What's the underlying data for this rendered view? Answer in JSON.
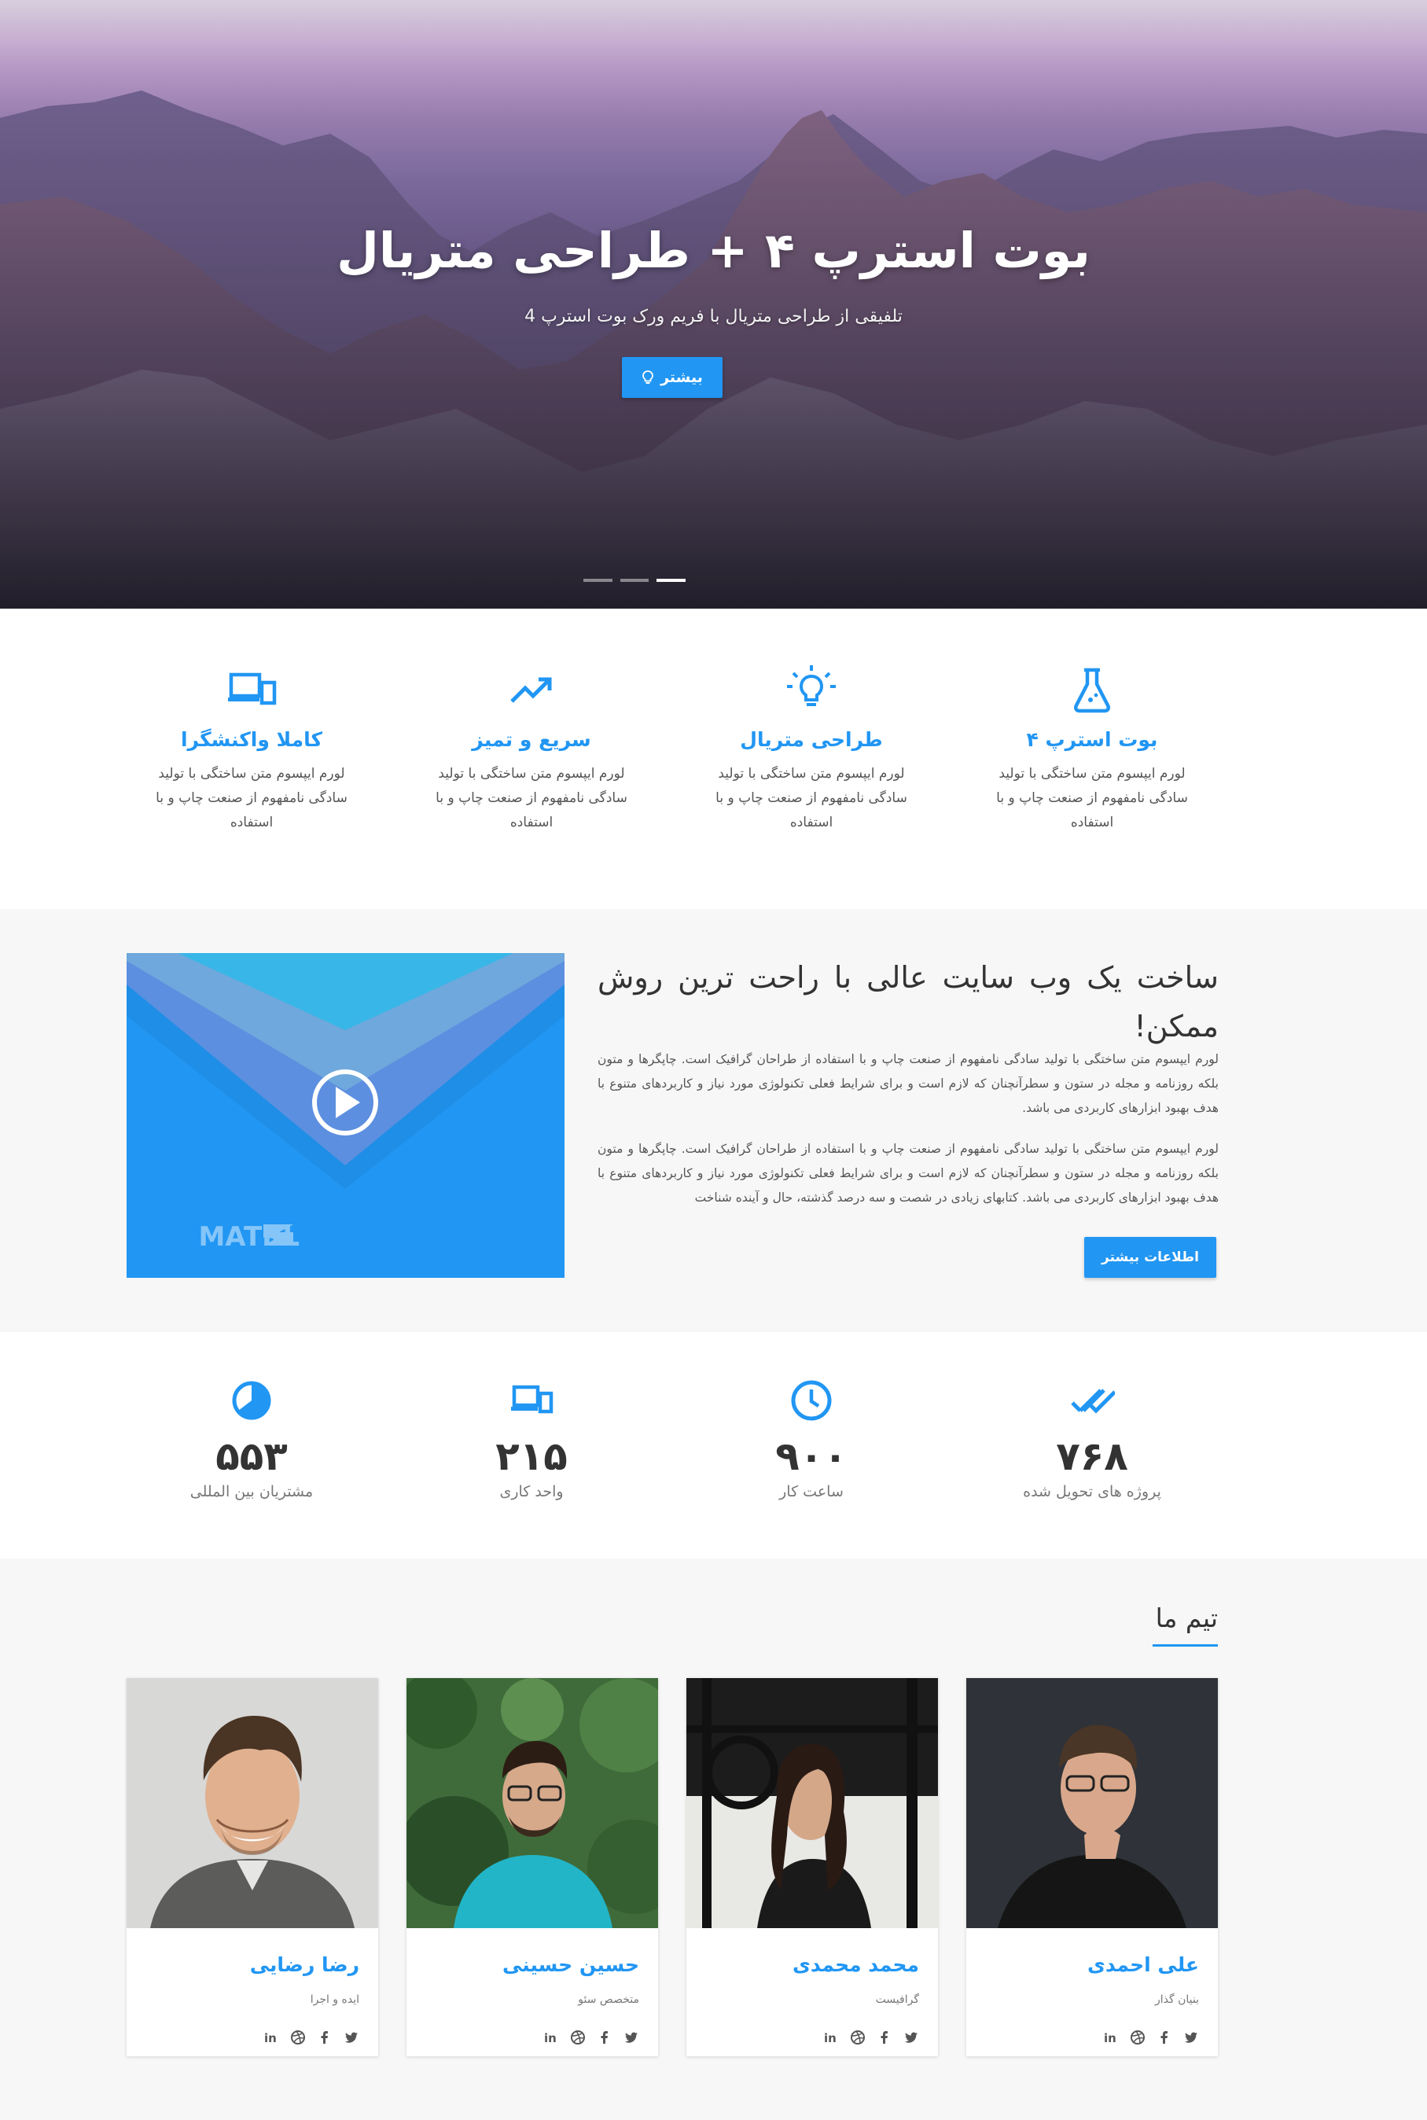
{
  "hero": {
    "title": "بوت استرپ ۴ + طراحی متریال",
    "subtitle": "تلفیقی از طراحی متریال با فریم ورک بوت استرپ 4",
    "button_label": "بیشتر",
    "slide_count": 3,
    "active_slide": 3
  },
  "features": [
    {
      "icon": "flask-icon",
      "title": "بوت استرپ ۴",
      "text": "لورم ایپسوم متن ساختگی با تولید سادگی نامفهوم از صنعت چاپ و با استفاده"
    },
    {
      "icon": "lightbulb-icon",
      "title": "طراحی متریال",
      "text": "لورم ایپسوم متن ساختگی با تولید سادگی نامفهوم از صنعت چاپ و با استفاده"
    },
    {
      "icon": "trending-up-icon",
      "title": "سریع و تمیز",
      "text": "لورم ایپسوم متن ساختگی با تولید سادگی نامفهوم از صنعت چاپ و با استفاده"
    },
    {
      "icon": "devices-icon",
      "title": "کاملا واکنشگرا",
      "text": "لورم ایپسوم متن ساختگی با تولید سادگی نامفهوم از صنعت چاپ و با استفاده"
    }
  ],
  "about": {
    "title": "ساخت یک وب سایت عالی با راحت ترین روش ممکن!",
    "paragraph1": "لورم ایپسوم متن ساختگی با تولید سادگی نامفهوم از صنعت چاپ و با استفاده از طراحان گرافیک است. چاپگرها و متون بلکه روزنامه و مجله در ستون و سطرآنچنان که لازم است و برای شرایط فعلی تکنولوژی مورد نیاز و کاربردهای متنوع با هدف بهبود ابزارهای کاربردی می باشد.",
    "paragraph2": "لورم ایپسوم متن ساختگی با تولید سادگی نامفهوم از صنعت چاپ و با استفاده از طراحان گرافیک است. چاپگرها و متون بلکه روزنامه و مجله در ستون و سطرآنچنان که لازم است و برای شرایط فعلی تکنولوژی مورد نیاز و کاربردهای متنوع با هدف بهبود ابزارهای کاربردی می باشد. کتابهای زیادی در شصت و سه درصد گذشته، حال و آینده شناخت",
    "button_label": "اطلاعات بیشتر",
    "video_logo_text": "MATRL"
  },
  "stats": [
    {
      "icon": "double-check-icon",
      "value": "۷۶۸",
      "label": "پروژه های تحویل شده"
    },
    {
      "icon": "clock-icon",
      "value": "۹۰۰",
      "label": "ساعت کار"
    },
    {
      "icon": "devices-icon",
      "value": "۲۱۵",
      "label": "واحد کاری"
    },
    {
      "icon": "pie-icon",
      "value": "۵۵۳",
      "label": "مشتریان بین المللی"
    }
  ],
  "team": {
    "title": "تیم ما",
    "members": [
      {
        "name": "علی احمدی",
        "role": "بنیان گذار"
      },
      {
        "name": "محمد محمدی",
        "role": "گرافیست"
      },
      {
        "name": "حسین حسینی",
        "role": "متخصص سئو"
      },
      {
        "name": "رضا رضایی",
        "role": "ایده و اجرا"
      }
    ],
    "social_icons": [
      "twitter-icon",
      "facebook-icon",
      "dribbble-icon",
      "linkedin-icon"
    ]
  },
  "colors": {
    "accent": "#2196f3",
    "text": "#333333",
    "muted": "#777777",
    "section_bg": "#f7f7f7"
  }
}
